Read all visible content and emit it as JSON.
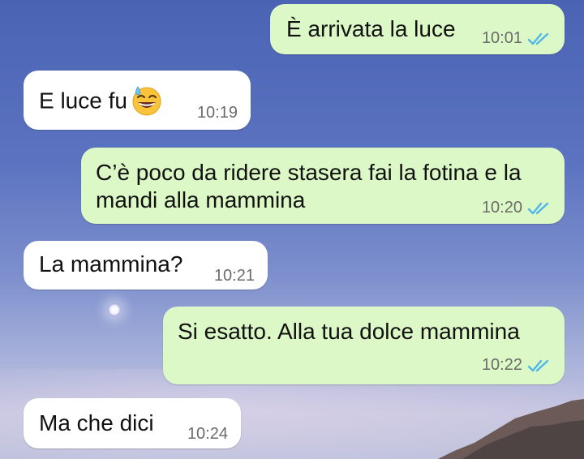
{
  "messages": [
    {
      "direction": "outgoing",
      "text": "È arrivata la luce",
      "time": "10:01",
      "status": "read"
    },
    {
      "direction": "incoming",
      "text": "E luce fu",
      "emoji": "grinning-face-with-sweat",
      "time": "10:19"
    },
    {
      "direction": "outgoing",
      "text_line1": "C’è poco da ridere stasera fai la fotina e la",
      "text_line2": "mandi alla mammina",
      "time": "10:20",
      "status": "read"
    },
    {
      "direction": "incoming",
      "text": "La mammina?",
      "time": "10:21"
    },
    {
      "direction": "outgoing",
      "text": "Si esatto. Alla tua dolce mammina",
      "time": "10:22",
      "status": "read"
    },
    {
      "direction": "incoming",
      "text": "Ma che dici",
      "time": "10:24"
    }
  ],
  "colors": {
    "outgoing_bubble": "#dcf8c6",
    "incoming_bubble": "#ffffff",
    "read_ticks": "#4fb6ec",
    "timestamp": "#6b6b6b"
  },
  "icons": {
    "read_status": "double-check-icon",
    "wallpaper_moon": "moon-icon"
  }
}
